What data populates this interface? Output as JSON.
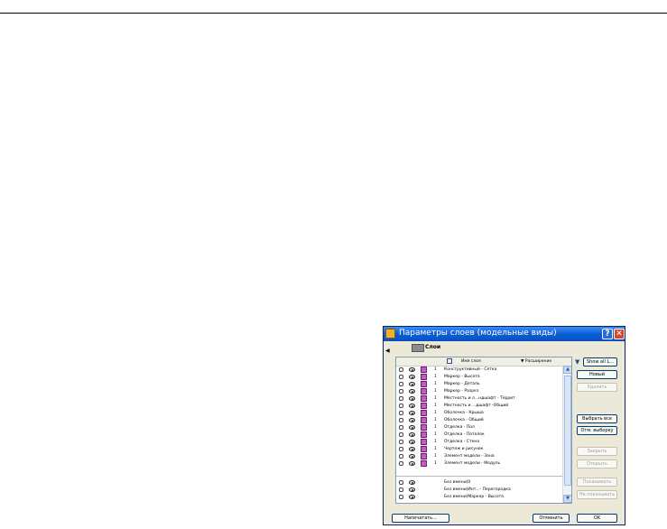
{
  "dialog": {
    "title": "Параметры слоев (модельные виды)",
    "help_label": "?",
    "close_label": "✕"
  },
  "tree": {
    "label": "Слои"
  },
  "list": {
    "header": {
      "name": "Имя слоя",
      "extension": "▼ Расширение"
    },
    "rows": [
      {
        "num": "1",
        "name": "Конструктивный - Сетка"
      },
      {
        "num": "1",
        "name": "Маркер - Высота"
      },
      {
        "num": "1",
        "name": "Маркер - Деталь"
      },
      {
        "num": "1",
        "name": "Маркер - Разрез"
      },
      {
        "num": "1",
        "name": "Местность и л...ндшафт - Террит"
      },
      {
        "num": "1",
        "name": "Местность и ...дшафт -Общий"
      },
      {
        "num": "1",
        "name": "Оболочка - Крыша"
      },
      {
        "num": "1",
        "name": "Оболочка - Общий"
      },
      {
        "num": "1",
        "name": "Отделка - Пол"
      },
      {
        "num": "1",
        "name": "Отделка - Потолок"
      },
      {
        "num": "1",
        "name": "Отделка - Стена"
      },
      {
        "num": "1",
        "name": "Чертеж и рисунок"
      },
      {
        "num": "1",
        "name": "Элемент модели - Зона"
      },
      {
        "num": "1",
        "name": "Элемент модели - Модуль"
      }
    ],
    "bottom_rows": [
      {
        "name": "Без имени(0"
      },
      {
        "name": "Без имени(Инт...- Перегородка"
      },
      {
        "name": "Без имени(Маркер - Высота"
      }
    ]
  },
  "buttons": {
    "show_all": "Show all L...",
    "new": "Новый",
    "delete": "Удалить",
    "select_all": "Выбрать все",
    "deselect": "Отм. выборку",
    "close_layer": "Закрыть",
    "open_layer": "Открыть",
    "show": "Показывать",
    "hide": "Не показывать",
    "print": "Напечатать...",
    "cancel": "Отменить",
    "ok": "OK"
  }
}
